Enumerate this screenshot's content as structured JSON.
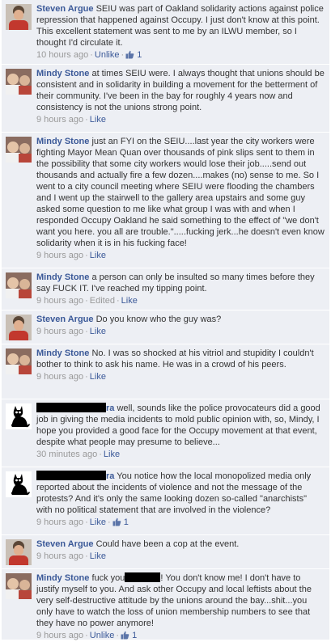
{
  "comments": [
    {
      "author": "Steven Argue",
      "text": "SEIU was part of Oakland solidarity actions against police repression that happened against Occupy. I just don't know at this point. This excellent statement was sent to me by an ILWU member, so I thought I'd circulate it.",
      "time": "10 hours ago",
      "action": "Unlike",
      "likes": "1",
      "avatar_icon": "steven-avatar"
    },
    {
      "author": "Mindy Stone",
      "text": "at times SEIU were. I always thought that unions should be consistent and in solidarity in building a movement for the betterment of their community. I've been in the bay for roughly 4 years now and consistency is not the unions strong point.",
      "time": "9 hours ago",
      "action": "Like",
      "avatar_icon": "mindy-avatar"
    },
    {
      "author": "Mindy Stone",
      "text": "just an FYI on the SEIU....last year the city workers were fighting Mayor Mean Quan over thousands of pink slips sent to them in the possibility that some city workers would lose their job.....send out thousands and actually fire a few dozen....makes (no) sense to me. So I went to a city council meeting where SEIU were flooding the chambers and I went up the stairwell to the gallery area upstairs and some guy asked some question to me like what group I was with and when I responded Occupy Oakland he said something to the effect of \"we don't want you here. you all are trouble.\".....fucking jerk...he doesn't even know solidarity when it is in his fucking face!",
      "time": "9 hours ago",
      "action": "Like",
      "avatar_icon": "mindy-avatar"
    },
    {
      "author": "Mindy Stone",
      "text": "a person can only be insulted so many times before they say FUCK IT. I've reached my tipping point.",
      "time": "9 hours ago",
      "edited": "Edited",
      "action": "Like",
      "avatar_icon": "mindy-avatar"
    },
    {
      "author": "Steven Argue",
      "text": "Do you know who the guy was?",
      "time": "9 hours ago",
      "action": "Like",
      "avatar_icon": "steven-avatar"
    },
    {
      "author": "Mindy Stone",
      "text": "No. I was so shocked at his vitriol and stupidity I couldn't bother to think to ask his name. He was in a crowd of his peers.",
      "time": "9 hours ago",
      "action": "Like",
      "avatar_icon": "mindy-avatar"
    },
    {
      "author": "ra",
      "text": "well, sounds like the police provocateurs did a good job in giving the media incidents to mold public opinion with, so, Mindy, I hope you provided a good face for the Occupy movement at that event, despite what people may presume to believe...",
      "time": "30 minutes ago",
      "action": "Like",
      "avatar_icon": "black-cat-icon"
    },
    {
      "author": "ra",
      "text": "You notice how the local monopolized media only reported about the incidents of violence and not the message of the protests? And it's only the same looking dozen so-called \"anarchists\" with no political statement that are involved in the violence?",
      "time": "9 hours ago",
      "action": "Like",
      "likes": "1",
      "avatar_icon": "black-cat-icon"
    },
    {
      "author": "Steven Argue",
      "text": "Could have been a cop at the event.",
      "time": "9 hours ago",
      "action": "Like",
      "avatar_icon": "steven-avatar"
    },
    {
      "author": "Mindy Stone",
      "text_before": "fuck you",
      "text": "! You don't know me! I don't have to justify myself to you. And ask other Occupy and local leftists about the very self-destructive attitude by the unions around the bay...shit...you only have to watch the loss of union membership numbers to see that they have no power anymore!",
      "time": "9 hours ago",
      "action": "Unlike",
      "likes": "1",
      "avatar_icon": "mindy-avatar"
    }
  ],
  "colors": {
    "background": "#edeff4",
    "link": "#3b5998",
    "meta": "#999999",
    "text": "#333333"
  }
}
